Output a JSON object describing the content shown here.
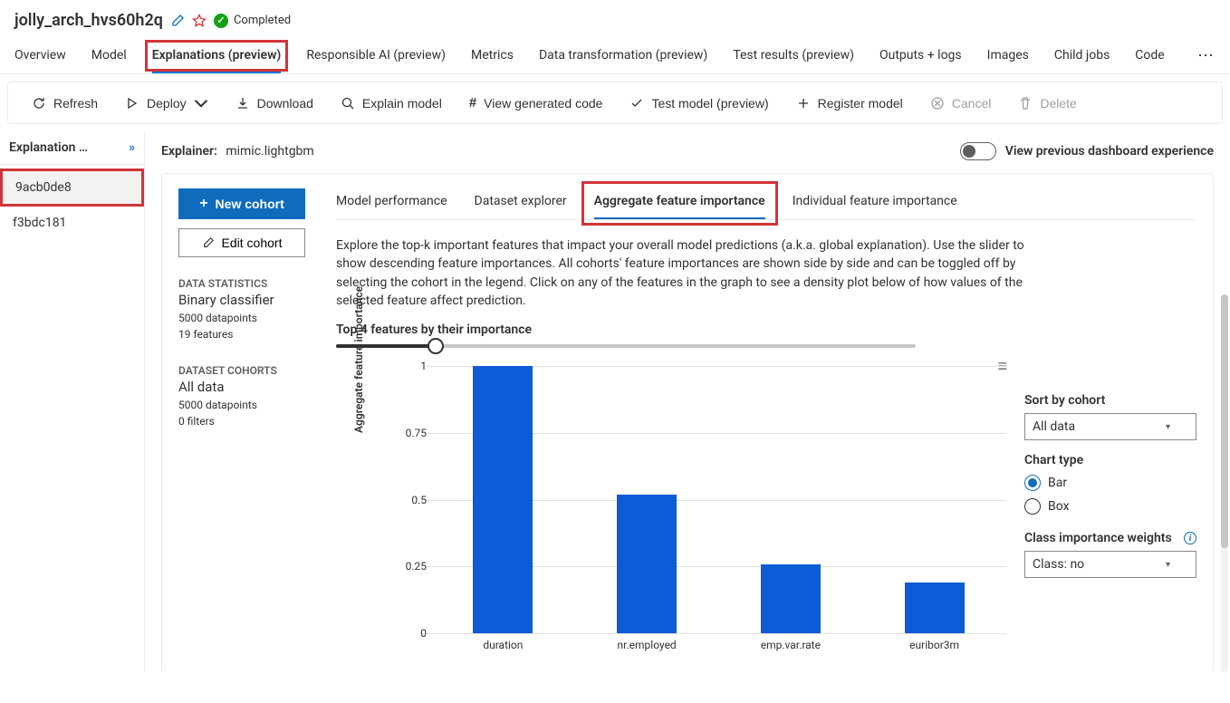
{
  "header": {
    "title": "jolly_arch_hvs60h2q",
    "status": "Completed"
  },
  "tabs": [
    "Overview",
    "Model",
    "Explanations (preview)",
    "Responsible AI (preview)",
    "Metrics",
    "Data transformation (preview)",
    "Test results (preview)",
    "Outputs + logs",
    "Images",
    "Child jobs",
    "Code"
  ],
  "active_tab_index": 2,
  "toolbar": {
    "refresh": "Refresh",
    "deploy": "Deploy",
    "download": "Download",
    "explain": "Explain model",
    "view_code": "View generated code",
    "test_model": "Test model (preview)",
    "register": "Register model",
    "cancel": "Cancel",
    "delete": "Delete"
  },
  "side": {
    "header": "Explanation …",
    "items": [
      "9acb0de8",
      "f3bdc181"
    ],
    "selected_index": 0
  },
  "explainer": {
    "label": "Explainer:",
    "value": "mimic.lightgbm",
    "toggle_label": "View previous dashboard experience"
  },
  "cohort": {
    "new_btn": "New cohort",
    "edit_btn": "Edit cohort",
    "stats_head": "DATA STATISTICS",
    "model_type": "Binary classifier",
    "datapoints": "5000 datapoints",
    "features": "19 features",
    "cohorts_head": "DATASET COHORTS",
    "cohort_name": "All data",
    "cohort_dp": "5000 datapoints",
    "filters": "0 filters"
  },
  "dash_tabs": [
    "Model performance",
    "Dataset explorer",
    "Aggregate feature importance",
    "Individual feature importance"
  ],
  "dash_active_index": 2,
  "description": "Explore the top-k important features that impact your overall model predictions (a.k.a. global explanation). Use the slider to show descending feature importances. All cohorts' feature importances are shown side by side and can be toggled off by selecting the cohort in the legend. Click on any of the features in the graph to see a density plot below of how values of the selected feature affect prediction.",
  "slider_label": "Top 4 features by their importance",
  "controls": {
    "sort_label": "Sort by cohort",
    "sort_value": "All data",
    "chart_type_label": "Chart type",
    "chart_type_options": [
      "Bar",
      "Box"
    ],
    "chart_type_selected": "Bar",
    "class_weights_label": "Class importance weights",
    "class_weights_value": "Class: no"
  },
  "chart_data": {
    "type": "bar",
    "title": "",
    "xlabel": "",
    "ylabel": "Aggregate feature importance",
    "ylim": [
      0,
      1
    ],
    "yticks": [
      0,
      0.25,
      0.5,
      0.75,
      1
    ],
    "categories": [
      "duration",
      "nr.employed",
      "emp.var.rate",
      "euribor3m"
    ],
    "values": [
      1.0,
      0.52,
      0.26,
      0.19
    ],
    "series_color": "#0b5cd6"
  }
}
